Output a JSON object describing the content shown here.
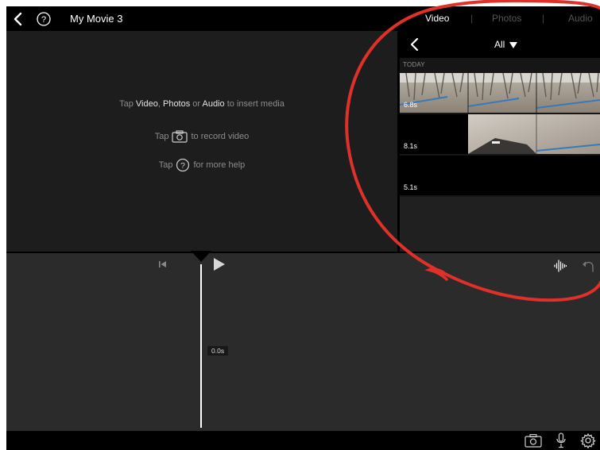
{
  "window": {
    "title": "My Movie 3"
  },
  "top_bar": {
    "back_icon": "chevron-left-icon",
    "help_icon": "question-circle-icon",
    "media_tabs": [
      {
        "label": "Video",
        "selected": true
      },
      {
        "label": "Photos",
        "selected": false
      },
      {
        "label": "Audio",
        "selected": false
      }
    ],
    "separator": "|"
  },
  "preview": {
    "hint_insert": {
      "prefix": "Tap ",
      "video": "Video",
      "sep1": ", ",
      "photos": "Photos",
      "sep2": " or ",
      "audio": "Audio",
      "suffix": " to insert media"
    },
    "hint_record": {
      "prefix": "Tap",
      "suffix": "to record video"
    },
    "hint_help": {
      "prefix": "Tap",
      "suffix": "for more help"
    }
  },
  "media_browser": {
    "filter_label": "All",
    "filter_icon": "triangle-down-icon",
    "section_label": "TODAY",
    "clips": [
      {
        "duration": "6.8s"
      },
      {
        "duration": "8.1s"
      },
      {
        "duration": "5.1s"
      }
    ]
  },
  "timeline": {
    "time_label": "0.0s",
    "icons": [
      "skip-to-start-icon",
      "play-icon",
      "waveform-icon",
      "undo-icon"
    ]
  },
  "bottom_bar": {
    "icons": [
      "camera-icon",
      "microphone-icon",
      "settings-icon"
    ]
  },
  "colors": {
    "background": "#000000",
    "preview": "#1d1d1d",
    "timeline": "#2b2b2b",
    "annotation": "#e0302a",
    "hint_text": "#8c8c8c"
  }
}
